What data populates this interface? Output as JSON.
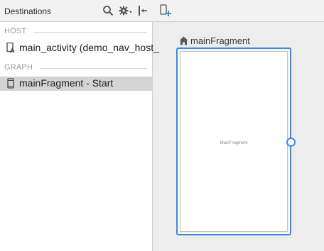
{
  "destinations_panel": {
    "title": "Destinations",
    "toolbar_icons": [
      "search-icon",
      "gear-icon",
      "collapse-panel-icon"
    ],
    "sections": [
      {
        "label": "HOST",
        "items": [
          {
            "label": "main_activity (demo_nav_host_",
            "icon": "activity-icon"
          }
        ]
      },
      {
        "label": "GRAPH",
        "items": [
          {
            "label": "mainFragment - Start",
            "icon": "fragment-icon",
            "selected": true
          }
        ]
      }
    ]
  },
  "canvas_toolbar": {
    "icons": [
      "new-destination-icon"
    ]
  },
  "graph_canvas": {
    "destination": {
      "title": "mainFragment",
      "start_icon": "home-icon",
      "preview_label": "MainFragment",
      "accent_color": "#3d8ae6"
    }
  }
}
